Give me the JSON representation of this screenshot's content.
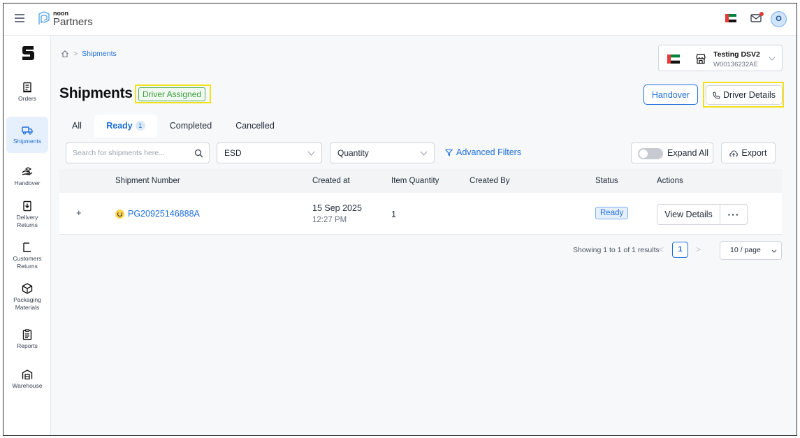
{
  "header": {
    "logo_small": "noon",
    "logo_big": "Partners",
    "avatar_initial": "O"
  },
  "sidebar": {
    "items": [
      {
        "label": "Orders",
        "icon": "orders-icon"
      },
      {
        "label": "Shipments",
        "icon": "truck-icon",
        "active": true
      },
      {
        "label": "Handover",
        "icon": "handover-icon"
      },
      {
        "label": "Delivery Returns",
        "icon": "delivery-returns-icon"
      },
      {
        "label": "Customers Returns",
        "icon": "customer-returns-icon"
      },
      {
        "label": "Packaging Materials",
        "icon": "package-icon"
      },
      {
        "label": "Reports",
        "icon": "reports-icon"
      },
      {
        "label": "Warehouse",
        "icon": "warehouse-icon"
      }
    ]
  },
  "breadcrumb": {
    "current": "Shipments",
    "separator": ">"
  },
  "store": {
    "name": "Testing DSV2",
    "code": "W00136232AE"
  },
  "page": {
    "title": "Shipments",
    "status_badge": "Driver Assigned",
    "handover_label": "Handover",
    "driver_details_label": "Driver Details"
  },
  "tabs": [
    {
      "label": "All"
    },
    {
      "label": "Ready",
      "count": "1",
      "active": true
    },
    {
      "label": "Completed"
    },
    {
      "label": "Cancelled"
    }
  ],
  "filters": {
    "search_placeholder": "Search for shipments here...",
    "esd_label": "ESD",
    "quantity_label": "Quantity",
    "advanced_label": "Advanced Filters",
    "expand_label": "Expand All",
    "export_label": "Export"
  },
  "table": {
    "columns": [
      "Shipment Number",
      "Created at",
      "Item Quantity",
      "Created By",
      "Status",
      "Actions"
    ],
    "rows": [
      {
        "expand": "+",
        "shipment_number": "PG20925146888A",
        "created_date": "15 Sep 2025",
        "created_time": "12:27 PM",
        "item_quantity": "1",
        "created_by": "",
        "status": "Ready",
        "view_label": "View Details",
        "more_label": "···"
      }
    ]
  },
  "pagination": {
    "summary": "Showing 1 to 1 of 1 results",
    "prev": "<",
    "current": "1",
    "next": ">",
    "per_page": "10 / page"
  },
  "colors": {
    "accent": "#1e6fd9",
    "success": "#3a9a3f",
    "highlight": "#f2e11a"
  }
}
